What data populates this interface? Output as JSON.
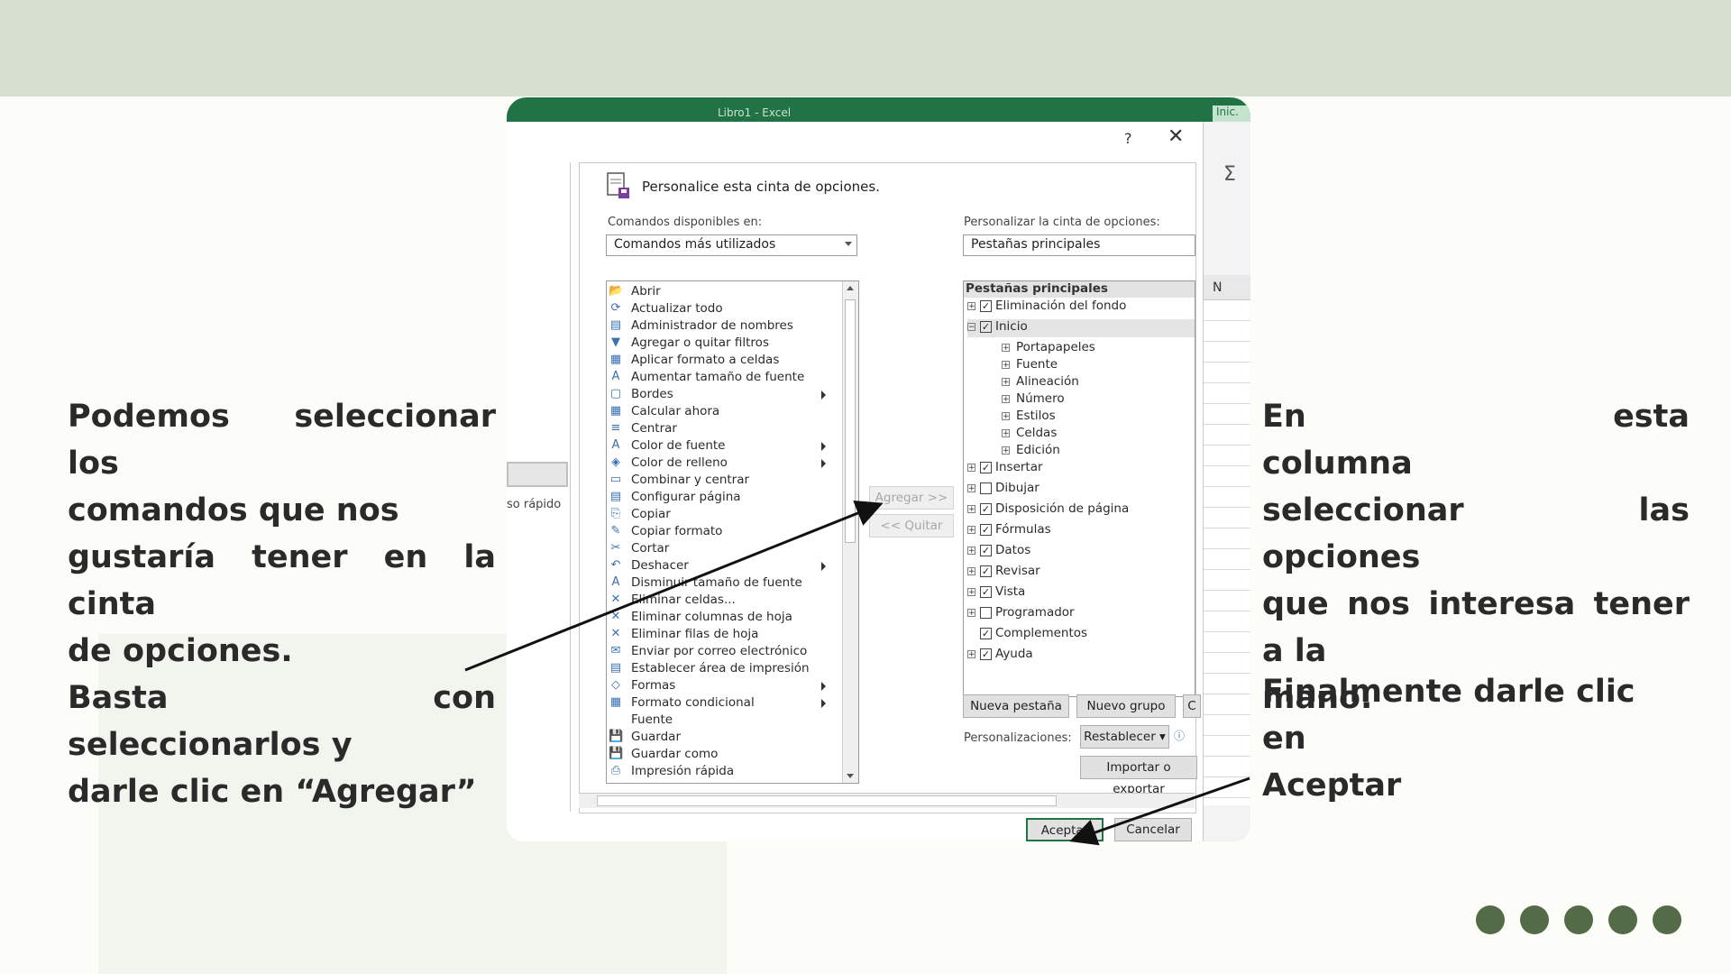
{
  "slide": {
    "left_caption": [
      "Podemos seleccionar los",
      "comandos que nos",
      "gustaría tener en la cinta",
      "de opciones.",
      "Basta con seleccionarlos y",
      "darle clic en “Agregar”"
    ],
    "right_caption": [
      "En esta columna",
      "seleccionar las opciones",
      "que nos interesa tener a la",
      "mano."
    ],
    "right_caption_b": [
      "Finalmente darle clic en",
      "Aceptar"
    ],
    "colors": {
      "band": "#d7dfd0",
      "dot": "#546b48",
      "excel_green": "#217346"
    }
  },
  "excel": {
    "window_title": "Libro1  -  Excel",
    "tab_stub": "Inic.",
    "left_stub_text": "so rápido",
    "column_header": "N",
    "help_label": "?",
    "close_label": "✕"
  },
  "dialog": {
    "heading": "Personalice esta cinta de opciones.",
    "commands_label": "Comandos disponibles en:",
    "commands_dropdown": "Comandos más utilizados",
    "ribbon_label": "Personalizar la cinta de opciones:",
    "ribbon_dropdown": "Pestañas principales",
    "commands": [
      {
        "label": "Abrir",
        "icon": "📂"
      },
      {
        "label": "Actualizar todo",
        "icon": "⟳"
      },
      {
        "label": "Administrador de nombres",
        "icon": "▤"
      },
      {
        "label": "Agregar o quitar filtros",
        "icon": "▼"
      },
      {
        "label": "Aplicar formato a celdas",
        "icon": "▦"
      },
      {
        "label": "Aumentar tamaño de fuente",
        "icon": "A"
      },
      {
        "label": "Bordes",
        "icon": "▢",
        "sub": true
      },
      {
        "label": "Calcular ahora",
        "icon": "▦"
      },
      {
        "label": "Centrar",
        "icon": "≡"
      },
      {
        "label": "Color de fuente",
        "icon": "A",
        "sub": true
      },
      {
        "label": "Color de relleno",
        "icon": "◈",
        "sub": true
      },
      {
        "label": "Combinar y centrar",
        "icon": "▭"
      },
      {
        "label": "Configurar página",
        "icon": "▤"
      },
      {
        "label": "Copiar",
        "icon": "⎘"
      },
      {
        "label": "Copiar formato",
        "icon": "✎"
      },
      {
        "label": "Cortar",
        "icon": "✂"
      },
      {
        "label": "Deshacer",
        "icon": "↶",
        "sub": true
      },
      {
        "label": "Disminuir tamaño de fuente",
        "icon": "A"
      },
      {
        "label": "Eliminar celdas...",
        "icon": "✕"
      },
      {
        "label": "Eliminar columnas de hoja",
        "icon": "✕"
      },
      {
        "label": "Eliminar filas de hoja",
        "icon": "✕"
      },
      {
        "label": "Enviar por correo electrónico",
        "icon": "✉"
      },
      {
        "label": "Establecer área de impresión",
        "icon": "▤"
      },
      {
        "label": "Formas",
        "icon": "◇",
        "sub": true
      },
      {
        "label": "Formato condicional",
        "icon": "▦",
        "sub": true
      },
      {
        "label": "Fuente",
        "icon": "",
        "sub": false
      },
      {
        "label": "Guardar",
        "icon": "💾"
      },
      {
        "label": "Guardar como",
        "icon": "💾"
      },
      {
        "label": "Impresión rápida",
        "icon": "⎙"
      }
    ],
    "add_button": "Agregar >>",
    "remove_button": "<< Quitar",
    "tree_header": "Pestañas principales",
    "tree": [
      {
        "label": "Eliminación del fondo",
        "pm": "+",
        "checked": true
      },
      {
        "label": "Inicio",
        "pm": "−",
        "checked": true,
        "selected": true
      },
      {
        "label": "Portapapeles",
        "pm": "+",
        "child": true
      },
      {
        "label": "Fuente",
        "pm": "+",
        "child": true
      },
      {
        "label": "Alineación",
        "pm": "+",
        "child": true
      },
      {
        "label": "Número",
        "pm": "+",
        "child": true
      },
      {
        "label": "Estilos",
        "pm": "+",
        "child": true
      },
      {
        "label": "Celdas",
        "pm": "+",
        "child": true
      },
      {
        "label": "Edición",
        "pm": "+",
        "child": true
      },
      {
        "label": "Insertar",
        "pm": "+",
        "checked": true
      },
      {
        "label": "Dibujar",
        "pm": "+",
        "checked": false
      },
      {
        "label": "Disposición de página",
        "pm": "+",
        "checked": true
      },
      {
        "label": "Fórmulas",
        "pm": "+",
        "checked": true
      },
      {
        "label": "Datos",
        "pm": "+",
        "checked": true
      },
      {
        "label": "Revisar",
        "pm": "+",
        "checked": true
      },
      {
        "label": "Vista",
        "pm": "+",
        "checked": true
      },
      {
        "label": "Programador",
        "pm": "+",
        "checked": false
      },
      {
        "label": "Complementos",
        "pm": "",
        "checked": true
      },
      {
        "label": "Ayuda",
        "pm": "+",
        "checked": true
      }
    ],
    "new_tab_button": "Nueva pestaña",
    "new_group_button": "Nuevo grupo",
    "rename_stub": "C",
    "customizations_label": "Personalizaciones:",
    "reset_button": "Restablecer ▾",
    "import_export_button": "Importar o exportar",
    "ok_button": "Aceptar",
    "cancel_button": "Cancelar"
  }
}
